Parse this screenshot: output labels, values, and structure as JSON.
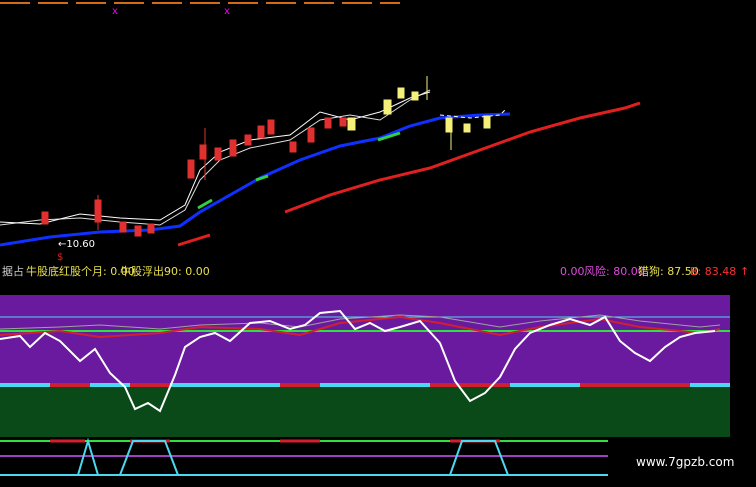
{
  "top_cut_text": "...",
  "price_panel": {
    "low_label": "←10.60",
    "marker_char": "$"
  },
  "status_bar": {
    "left_label": "据占",
    "bull_bottom_months": "牛股底红股个月: 0.00",
    "bull_out": "牛股浮出90: 0.00",
    "zero_value": "0.00",
    "risk": "风险: 80.00",
    "hunter": "猎狗: 87.50",
    "b_value": "B: 83.48",
    "arrow": "↑"
  },
  "watermark": "www.7gpzb.com",
  "colors": {
    "candle_up": "#e03030",
    "candle_yellow": "#f4f07a",
    "ma_blue": "#1030ff",
    "ma_red": "#e02020",
    "purple": "#6a1a9e",
    "green_band": "#0a4a18",
    "cyan": "#4ad9f0",
    "white": "#ffffff"
  }
}
